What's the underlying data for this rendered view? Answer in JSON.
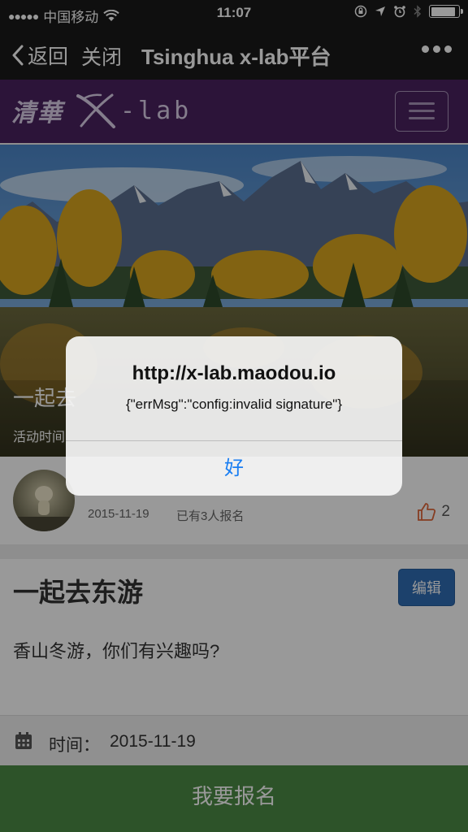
{
  "status_bar": {
    "carrier": "中国移动",
    "time": "11:07"
  },
  "nav": {
    "back_label": "返回",
    "close_label": "关闭",
    "title": "Tsinghua x-lab平台"
  },
  "site": {
    "logo_cn": "清華",
    "logo_lab": "-lab",
    "brand_color": "#4a2260"
  },
  "hero": {
    "title": "一起去",
    "subtitle": "活动时间"
  },
  "event": {
    "date": "2015-11-19",
    "signup_count": "已有3人报名",
    "likes": "2",
    "title": "一起去东游",
    "edit_label": "编辑",
    "description": "香山冬游，你们有兴趣吗?",
    "time_label": "时间：",
    "time_value": "2015-11-19",
    "register_label": "我要报名"
  },
  "alert": {
    "title": "http://x-lab.maodou.io",
    "message": "{\"errMsg\":\"config:invalid signature\"}",
    "ok_label": "好"
  },
  "colors": {
    "accent_button": "#2f6db4",
    "register_button": "#4b8a45",
    "alert_button_text": "#1a7ef2"
  },
  "icons": {
    "back": "chevron-left-icon",
    "more": "more-dots-icon",
    "menu": "hamburger-icon",
    "like": "thumbs-up-icon",
    "calendar": "calendar-icon"
  }
}
